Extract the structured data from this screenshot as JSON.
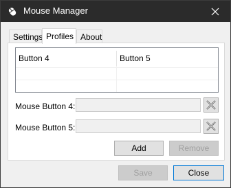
{
  "window": {
    "title": "Mouse Manager",
    "app_icon": "mouse-icon",
    "close_icon": "close-icon"
  },
  "tabs": [
    {
      "label": "Settings",
      "active": false
    },
    {
      "label": "Profiles",
      "active": true
    },
    {
      "label": "About",
      "active": false
    }
  ],
  "profiles": {
    "columns": [
      "Button 4",
      "Button 5"
    ],
    "rows": [],
    "fields": [
      {
        "label": "Mouse Button 4:",
        "value": "",
        "clear_icon": "clear-x-icon"
      },
      {
        "label": "Mouse Button 5:",
        "value": "",
        "clear_icon": "clear-x-icon"
      }
    ],
    "add_label": "Add",
    "remove_label": "Remove"
  },
  "footer": {
    "save_label": "Save",
    "close_label": "Close"
  },
  "colors": {
    "titlebar": "#2b2b2b",
    "accent": "#0078d7",
    "disabled_text": "#a0a0a0"
  }
}
